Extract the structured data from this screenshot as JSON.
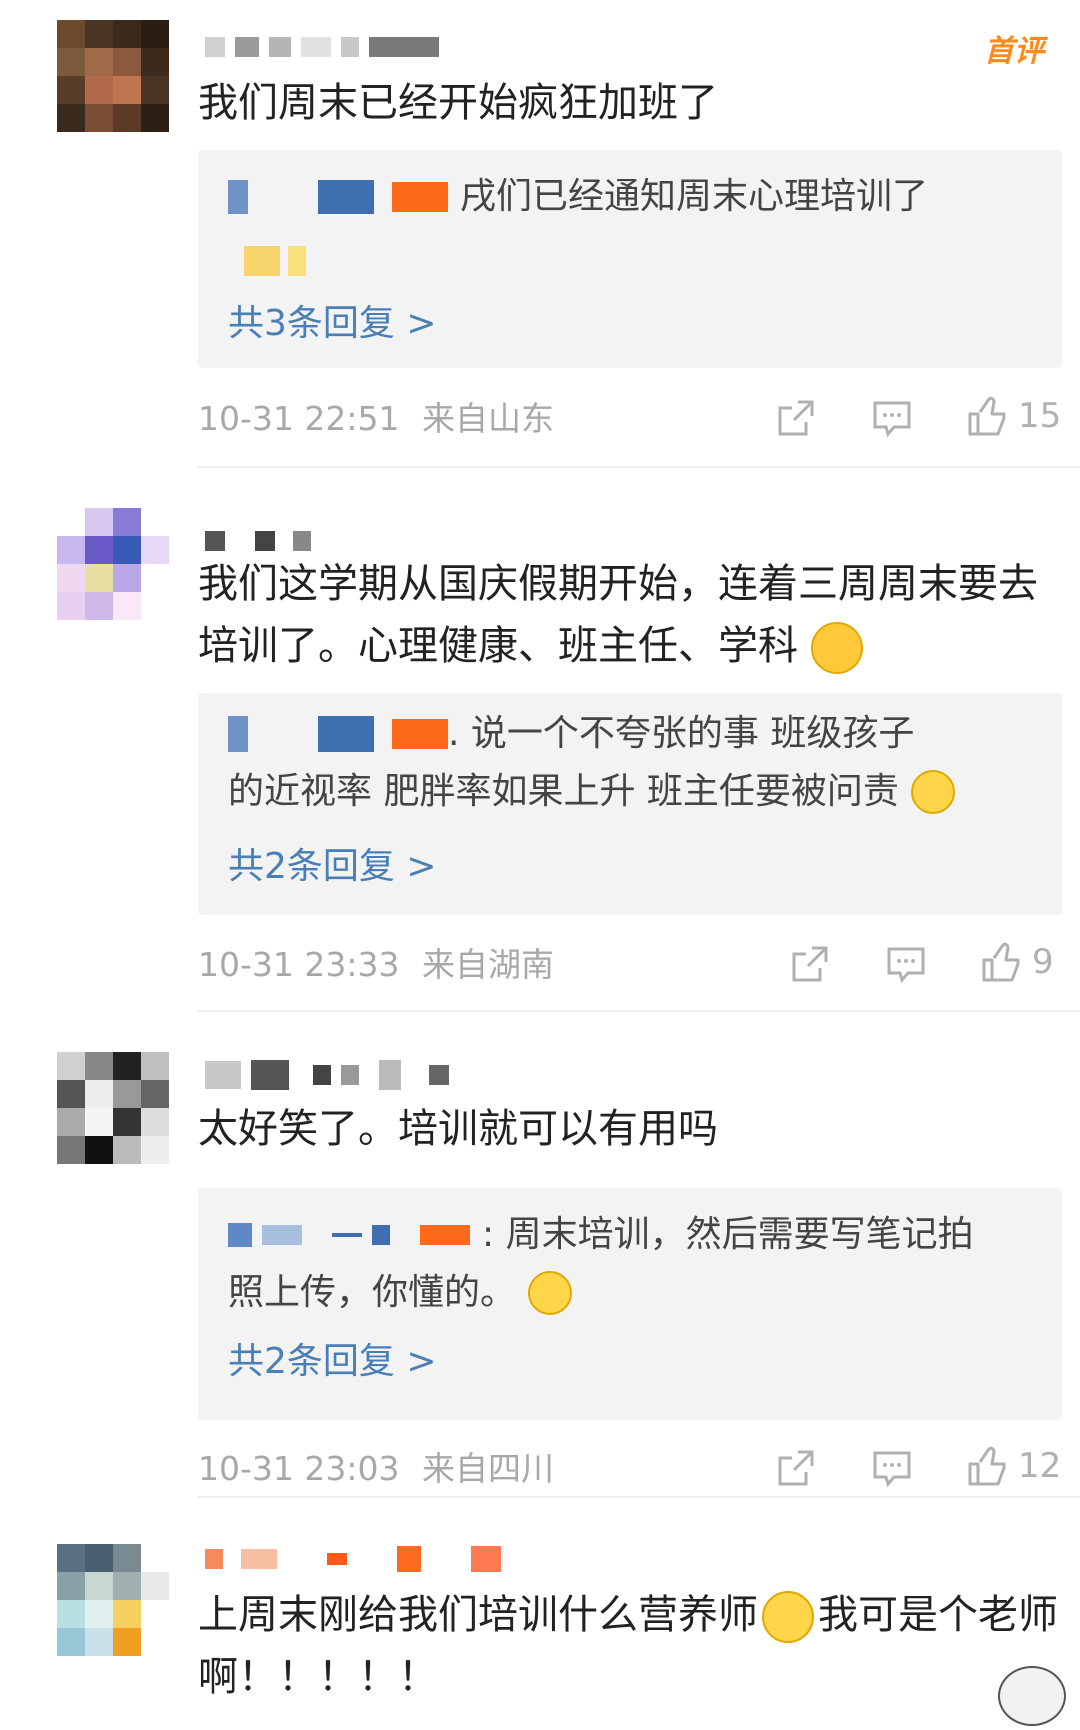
{
  "comments": [
    {
      "badge": "首评",
      "text": "我们周末已经开始疯狂加班了",
      "reply": {
        "lines": [
          "戌们已经通知周末心理培训了"
        ],
        "count": "共3条回复 >"
      },
      "time": "10-31 22:51",
      "location": "来自山东",
      "likes": "15"
    },
    {
      "text": "我们这学期从国庆假期开始，连着三周周末要去培训了。心理健康、班主任、学科",
      "reply": {
        "lines": [
          ". 说一个不夸张的事 班级孩子",
          "的近视率 肥胖率如果上升 班主任要被问责"
        ],
        "count": "共2条回复 >"
      },
      "time": "10-31 23:33",
      "location": "来自湖南",
      "likes": "9"
    },
    {
      "text": "太好笑了。培训就可以有用吗",
      "reply": {
        "lines": [
          ": 周末培训，然后需要写笔记拍",
          "照上传，你懂的。"
        ],
        "count": "共2条回复 >"
      },
      "time": "10-31 23:03",
      "location": "来自四川",
      "likes": "12"
    },
    {
      "text": "上周末刚给我们培训什么营养师",
      "text2": "我可是个老师啊！！！！！"
    }
  ],
  "icons": {
    "share": "share-icon",
    "comment": "comment-icon",
    "like": "thumbs-up-icon"
  },
  "colors": {
    "link": "#4a7fb5",
    "badge": "#ff8a1c",
    "meta": "#a8a8a8",
    "reply_bg": "#f3f3f3"
  }
}
